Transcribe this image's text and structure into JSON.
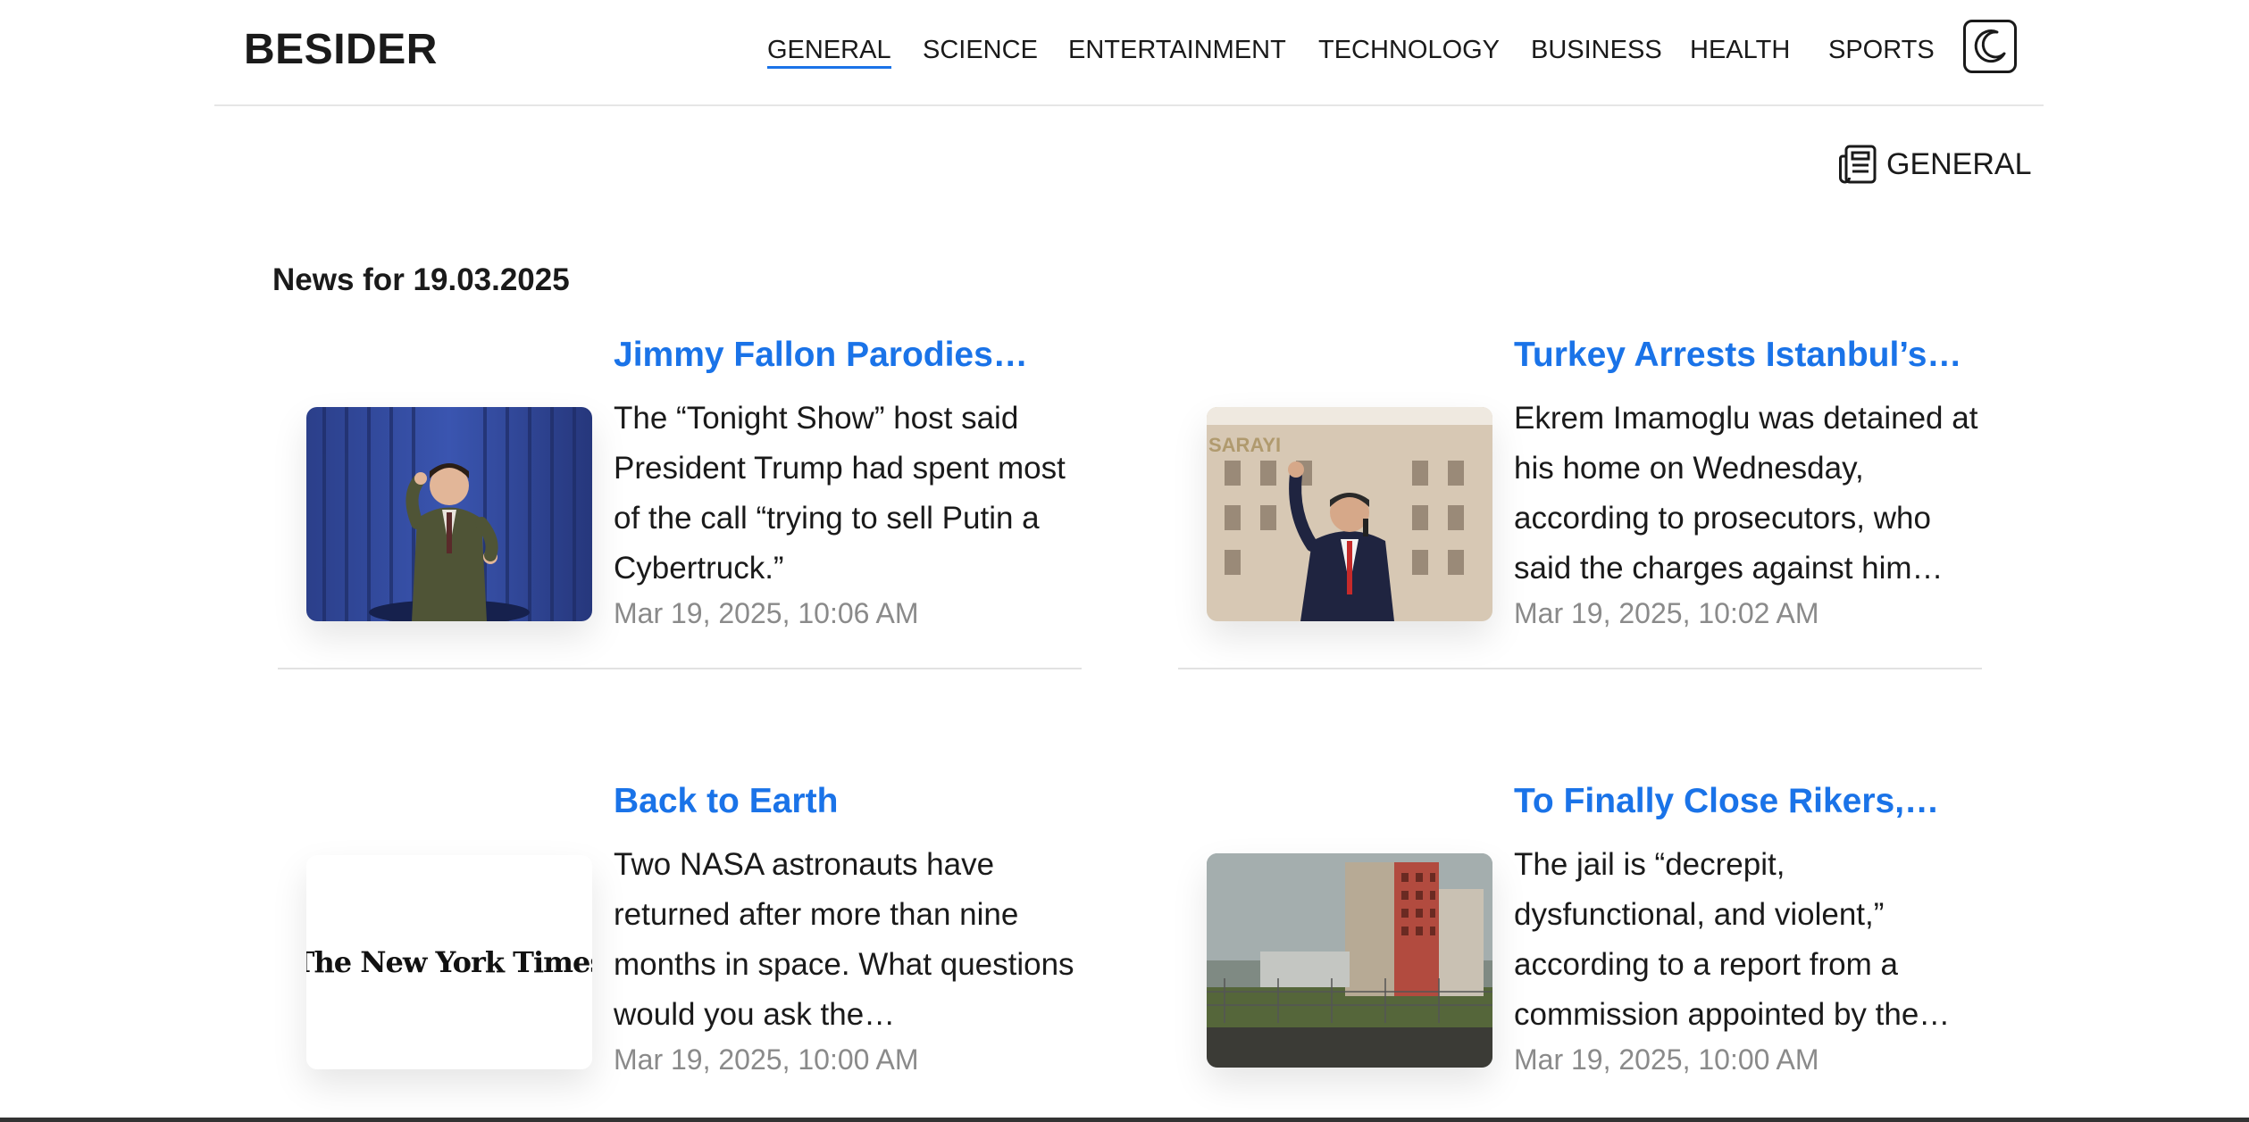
{
  "header": {
    "logo": "BESIDER",
    "nav": [
      {
        "label": "GENERAL",
        "active": true
      },
      {
        "label": "SCIENCE"
      },
      {
        "label": "ENTERTAINMENT"
      },
      {
        "label": "TECHNOLOGY"
      },
      {
        "label": "BUSINESS"
      },
      {
        "label": "HEALTH"
      },
      {
        "label": "SPORTS"
      }
    ],
    "theme_icon": "moon-icon"
  },
  "category": {
    "icon": "newspaper-icon",
    "label": "GENERAL"
  },
  "news_heading": "News for 19.03.2025",
  "articles": [
    {
      "title": "Jimmy Fallon Parodies…",
      "description": "The “Tonight Show” host said President Trump had spent most of the call “trying to sell Putin a Cybertruck.”",
      "time": "Mar 19, 2025, 10:06 AM"
    },
    {
      "title": "Turkey Arrests Istanbul’s…",
      "description": "Ekrem Imamoglu was detained at his home on Wednesday, according to prosecutors, who said the charges against him…",
      "time": "Mar 19, 2025, 10:02 AM",
      "thumb_text": "SARAYI"
    },
    {
      "title": "Back to Earth",
      "description": "Two NASA astronauts have returned after more than nine months in space. What questions would you ask the…",
      "time": "Mar 19, 2025, 10:00 AM",
      "thumb_text": "The New York Times"
    },
    {
      "title": "To Finally Close Rikers,…",
      "description": "The jail is “decrepit, dysfunctional, and violent,” according to a report from a commission appointed by the…",
      "time": "Mar 19, 2025, 10:00 AM"
    }
  ],
  "colors": {
    "accent": "#1a73e8",
    "text": "#1a1a1a",
    "muted": "#8a8a8a"
  }
}
